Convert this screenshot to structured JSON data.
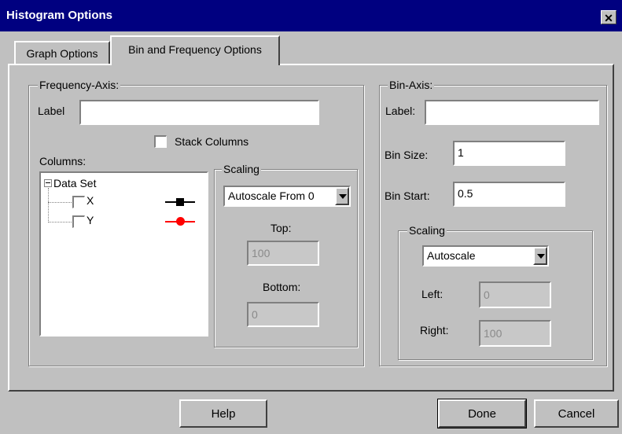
{
  "window": {
    "title": "Histogram Options",
    "close_glyph": "✕"
  },
  "tabs": [
    {
      "label": "Graph Options",
      "active": false
    },
    {
      "label": "Bin and Frequency Options",
      "active": true
    }
  ],
  "frequency_axis": {
    "group_label": "Frequency-Axis:",
    "label_caption": "Label",
    "label_value": "",
    "stack_columns_label": "Stack Columns",
    "stack_columns_checked": false,
    "columns_caption": "Columns:",
    "tree": {
      "root": "Data Set",
      "children": [
        {
          "label": "X",
          "marker": "square",
          "color": "#000000"
        },
        {
          "label": "Y",
          "marker": "circle",
          "color": "#ff0000"
        }
      ]
    },
    "scaling": {
      "group_label": "Scaling",
      "selected": "Autoscale From 0",
      "top_label": "Top:",
      "top_value": "100",
      "bottom_label": "Bottom:",
      "bottom_value": "0"
    }
  },
  "bin_axis": {
    "group_label": "Bin-Axis:",
    "label_caption": "Label:",
    "label_value": "",
    "bin_size_label": "Bin Size:",
    "bin_size_value": "1",
    "bin_start_label": "Bin Start:",
    "bin_start_value": "0.5",
    "scaling": {
      "group_label": "Scaling",
      "selected": "Autoscale",
      "left_label": "Left:",
      "left_value": "0",
      "right_label": "Right:",
      "right_value": "100"
    }
  },
  "buttons": {
    "help": "Help",
    "done": "Done",
    "cancel": "Cancel"
  }
}
